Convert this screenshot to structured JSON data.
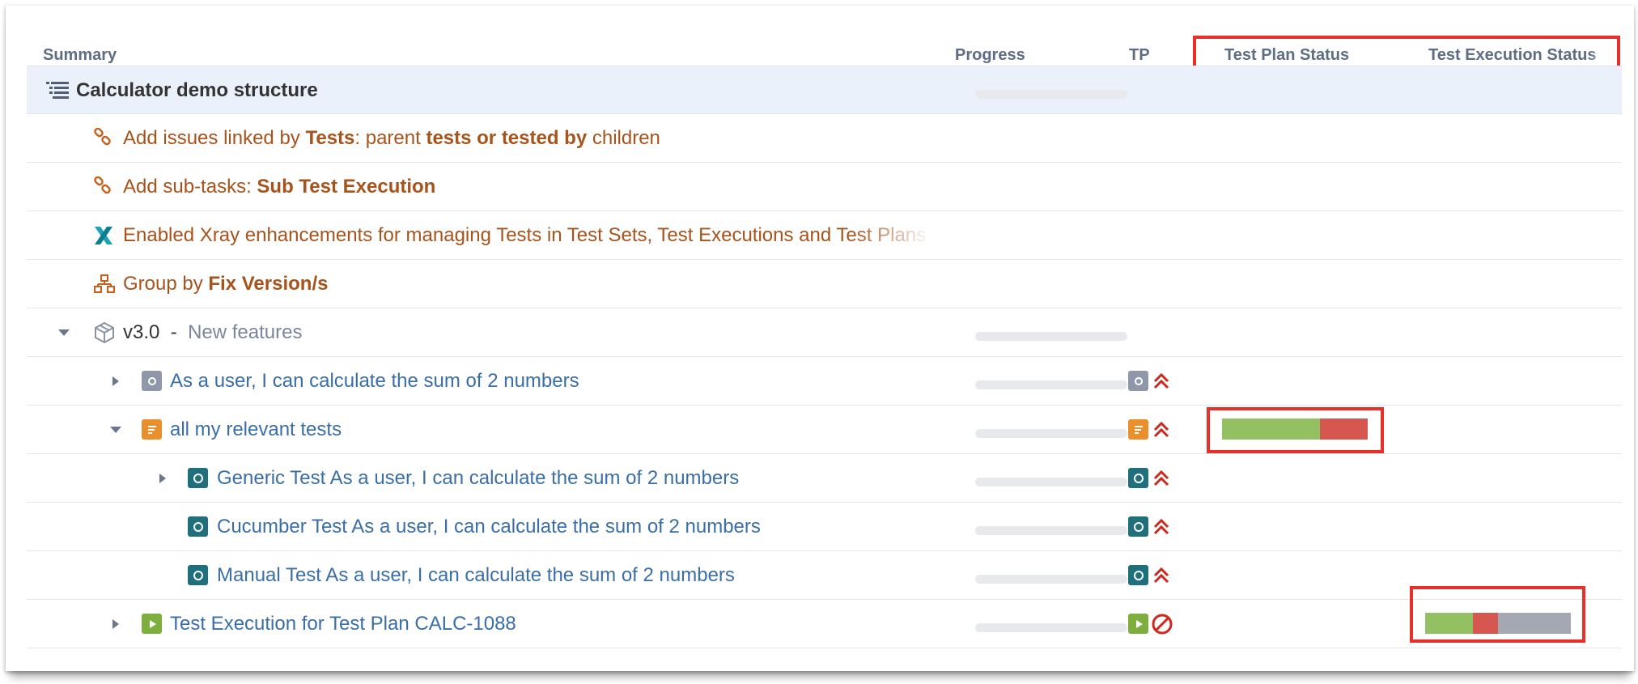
{
  "columns": {
    "summary": "Summary",
    "progress": "Progress",
    "tp": "TP",
    "test_plan_status": "Test Plan Status",
    "test_execution_status": "Test Execution Status"
  },
  "rows": [
    {
      "title": "Calculator demo structure",
      "icon": "structure-icon"
    },
    {
      "parts": [
        "Add issues linked by ",
        "Tests",
        ": parent ",
        "tests or tested by",
        " children"
      ],
      "icon": "link-icon"
    },
    {
      "parts": [
        "Add sub-tasks: ",
        "Sub Test Execution"
      ],
      "icon": "link-icon"
    },
    {
      "title": "Enabled Xray enhancements for managing Tests in Test Sets, Test Executions and Test Plans",
      "icon": "xray-icon"
    },
    {
      "parts": [
        "Group by ",
        "Fix Version/s"
      ],
      "icon": "hierarchy-icon"
    },
    {
      "version": "v3.0",
      "separator": "-",
      "description": "New features",
      "icon": "version-package-icon"
    },
    {
      "title": "As a user, I can calculate the sum of 2 numbers",
      "icon": "story-icon",
      "priority": "highest-priority-icon"
    },
    {
      "title": "all my relevant tests",
      "icon": "test-plan-icon",
      "priority": "highest-priority-icon",
      "test_plan_status": [
        {
          "status": "passed",
          "fraction": 0.67,
          "color": "#93c060"
        },
        {
          "status": "failed",
          "fraction": 0.33,
          "color": "#d6574f"
        }
      ]
    },
    {
      "title": "Generic Test As a user, I can calculate the sum of 2 numbers",
      "icon": "test-icon",
      "priority": "highest-priority-icon"
    },
    {
      "title": "Cucumber Test As a user, I can calculate the sum of 2 numbers",
      "icon": "test-icon",
      "priority": "highest-priority-icon"
    },
    {
      "title": "Manual Test As a user, I can calculate the sum of 2 numbers",
      "icon": "test-icon",
      "priority": "highest-priority-icon"
    },
    {
      "title": "Test Execution for Test Plan CALC-1088",
      "icon": "test-execution-icon",
      "priority": "blocker-icon",
      "test_execution_status": [
        {
          "status": "passed",
          "fraction": 0.33,
          "color": "#93c060"
        },
        {
          "status": "failed",
          "fraction": 0.17,
          "color": "#d6574f"
        },
        {
          "status": "todo",
          "fraction": 0.5,
          "color": "#a3a8b2"
        }
      ]
    }
  ]
}
